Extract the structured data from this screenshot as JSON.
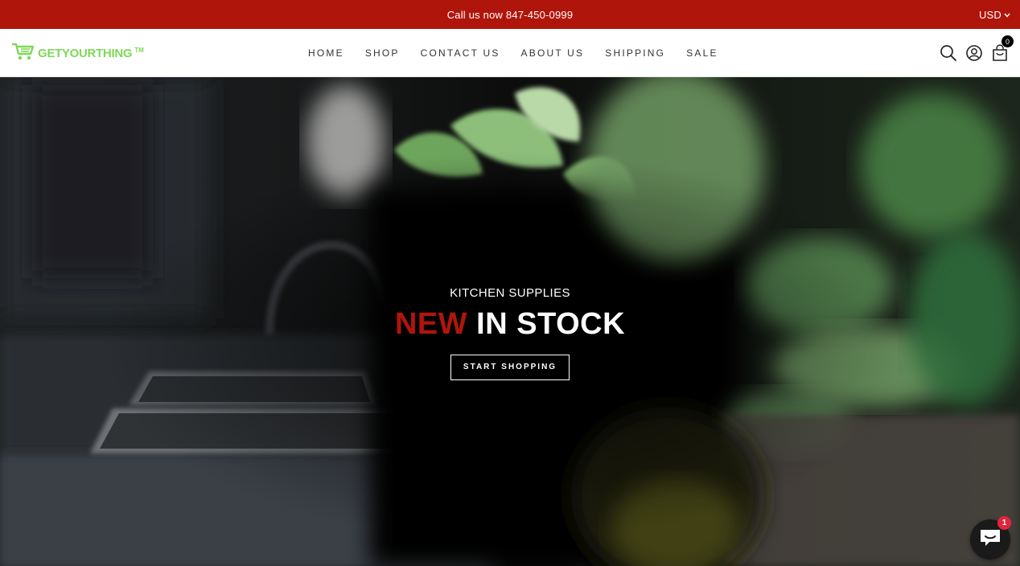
{
  "announcement": {
    "text": "Call us now 847-450-0999"
  },
  "currency": {
    "label": "USD",
    "chevron": "chevron-down-icon"
  },
  "logo": {
    "text": "GETYOURTHING",
    "tm": "TM",
    "icon": "shopping-cart-icon",
    "color": "#7ed957"
  },
  "nav": {
    "items": [
      {
        "label": "HOME"
      },
      {
        "label": "SHOP"
      },
      {
        "label": "CONTACT US"
      },
      {
        "label": "ABOUT US"
      },
      {
        "label": "SHIPPING"
      },
      {
        "label": "SALE"
      }
    ]
  },
  "header_icons": {
    "search": "search-icon",
    "account": "account-icon",
    "cart": "shopping-bag-icon",
    "cart_count": "0"
  },
  "hero": {
    "subtitle": "KITCHEN SUPPLIES",
    "title_accent": "NEW",
    "title_rest": " IN STOCK",
    "cta_label": "START SHOPPING"
  },
  "chat": {
    "icon": "chat-bubble-icon",
    "badge": "1"
  },
  "colors": {
    "brand_red": "#b0150b",
    "logo_green": "#7ed957",
    "badge_red": "#e0263c"
  }
}
